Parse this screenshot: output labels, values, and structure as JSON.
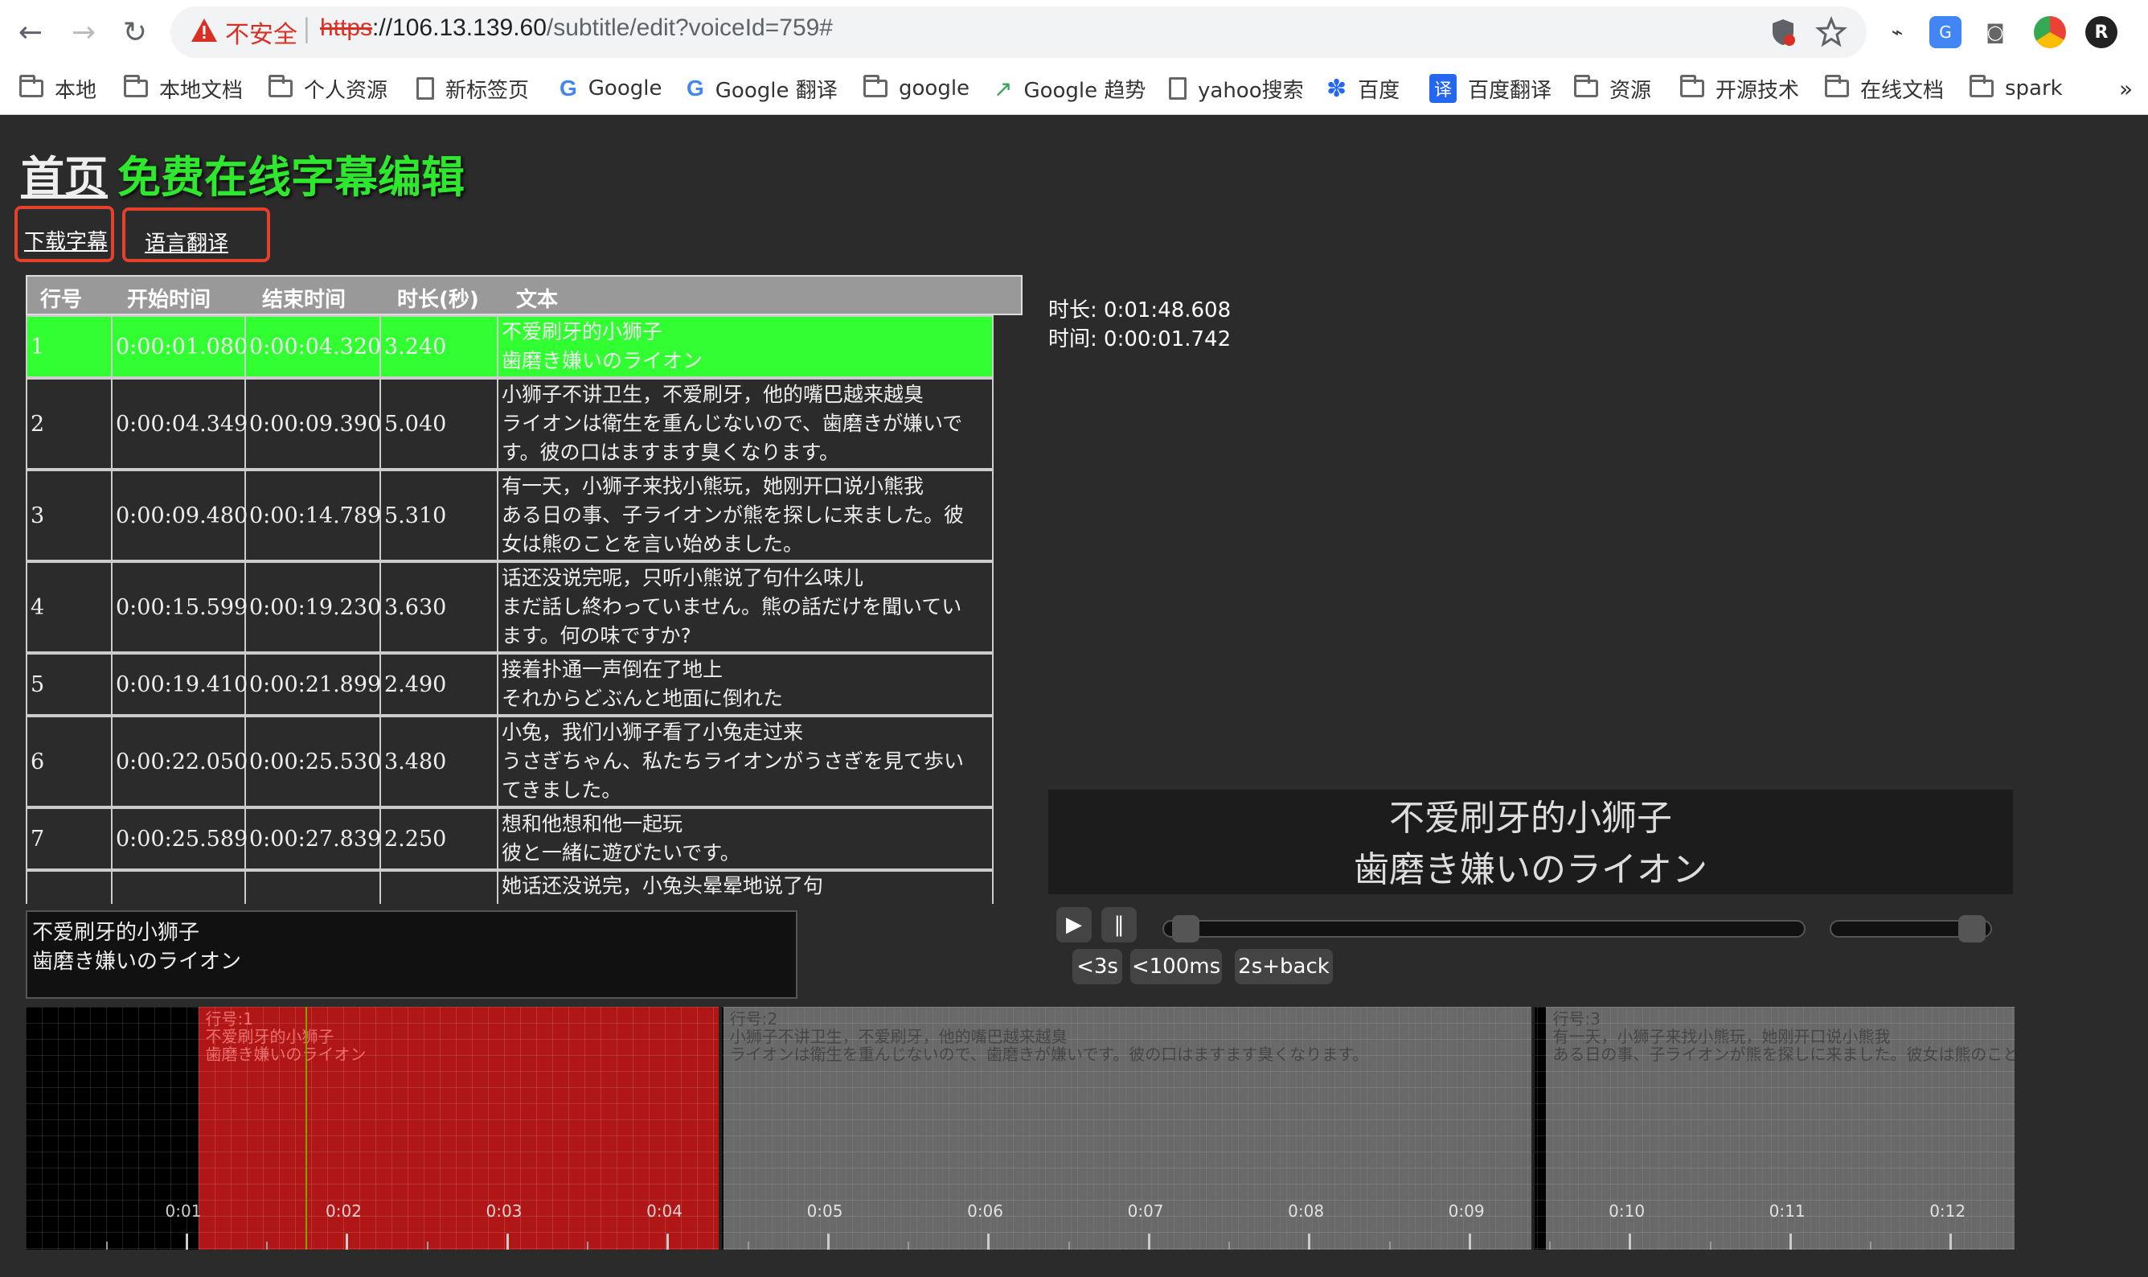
{
  "browser": {
    "insecure_label": "不安全",
    "separator": "|",
    "url_scheme": "https",
    "url_host": "://106.13.139.60",
    "url_path": "/subtitle/edit?voiceId=759#",
    "bookmarks": [
      "本地",
      "本地文档",
      "个人资源",
      "新标签页",
      "Google",
      "Google 翻译",
      "google",
      "Google 趋势",
      "yahoo搜索",
      "百度",
      "百度翻译",
      "资源",
      "开源技术",
      "在线文档",
      "spark"
    ],
    "more": "»"
  },
  "page": {
    "home_link": "首页",
    "title": "免费在线字幕编辑",
    "download_label": "下载字幕",
    "translate_label": "语言翻译"
  },
  "table": {
    "headers": [
      "行号",
      "开始时间",
      "结束时间",
      "时长(秒)",
      "文本"
    ],
    "rows": [
      {
        "no": "1",
        "start": "0:00:01.080",
        "end": "0:00:04.320",
        "dur": "3.240",
        "lines": [
          "不爱刷牙的小狮子",
          "歯磨き嫌いのライオン"
        ]
      },
      {
        "no": "2",
        "start": "0:00:04.349",
        "end": "0:00:09.390",
        "dur": "5.040",
        "lines": [
          "小狮子不讲卫生，不爱刷牙，他的嘴巴越来越臭",
          "ライオンは衛生を重んじないので、歯磨きが嫌いで",
          "す。彼の口はますます臭くなります。"
        ]
      },
      {
        "no": "3",
        "start": "0:00:09.480",
        "end": "0:00:14.789",
        "dur": "5.310",
        "lines": [
          "有一天，小狮子来找小熊玩，她刚开口说小熊我",
          "ある日の事、子ライオンが熊を探しに来ました。彼",
          "女は熊のことを言い始めました。"
        ]
      },
      {
        "no": "4",
        "start": "0:00:15.599",
        "end": "0:00:19.230",
        "dur": "3.630",
        "lines": [
          "话还没说完呢，只听小熊说了句什么味儿",
          "まだ話し終わっていません。熊の話だけを聞いてい",
          "ます。何の味ですか?"
        ]
      },
      {
        "no": "5",
        "start": "0:00:19.410",
        "end": "0:00:21.899",
        "dur": "2.490",
        "lines": [
          "接着扑通一声倒在了地上",
          "それからどぶんと地面に倒れた"
        ]
      },
      {
        "no": "6",
        "start": "0:00:22.050",
        "end": "0:00:25.530",
        "dur": "3.480",
        "lines": [
          "小兔，我们小狮子看了小兔走过来",
          "うさぎちゃん、私たちライオンがうさぎを見て歩い",
          "てきました。"
        ]
      },
      {
        "no": "7",
        "start": "0:00:25.589",
        "end": "0:00:27.839",
        "dur": "2.250",
        "lines": [
          "想和他想和他一起玩",
          "彼と一緒に遊びたいです。"
        ]
      },
      {
        "no": "",
        "start": "",
        "end": "",
        "dur": "",
        "lines": [
          "她话还没说完，小兔头晕晕地说了句"
        ]
      }
    ]
  },
  "editor_text": "不爱刷牙的小狮子\n歯磨き嫌いのライオン",
  "player": {
    "duration_label": "时长: 0:01:48.608",
    "time_label": "时间: 0:00:01.742",
    "caption_line1": "不爱刷牙的小狮子",
    "caption_line2": "歯磨き嫌いのライオン",
    "play": "▶",
    "pause": "‖",
    "btn_back3s": "<3s",
    "btn_back100ms": "<100ms",
    "btn_2s_back": "2s+back",
    "progress": 0.016,
    "volume": 0.95
  },
  "timeline": {
    "segments": [
      {
        "label": "行号:1",
        "line1": "不爱刷牙的小狮子",
        "line2": "歯磨き嫌いのライオン",
        "color": "#b01616"
      },
      {
        "label": "行号:2",
        "line1": "小狮子不讲卫生，不爱刷牙，他的嘴巴越来越臭",
        "line2": "ライオンは衛生を重んじないので、歯磨きが嫌いです。彼の口はますます臭くなります。",
        "color": "#8c8c8c"
      },
      {
        "label": "行号:3",
        "line1": "有一天，小狮子来找小熊玩，她刚开口说小熊我",
        "line2": "ある日の事、子ライオンが熊を探しに来ました。彼女は熊のこと",
        "color": "#8c8c8c"
      }
    ],
    "ticks": [
      "0:01",
      "0:02",
      "0:03",
      "0:04",
      "0:05",
      "0:06",
      "0:07",
      "0:08",
      "0:09",
      "0:10",
      "0:11",
      "0:12"
    ],
    "view_start_s": 0.0,
    "view_end_s": 12.4,
    "segment_times": [
      [
        1.08,
        4.32
      ],
      [
        4.349,
        9.39
      ],
      [
        9.48,
        14.789
      ]
    ],
    "cursor_s": 1.742
  }
}
